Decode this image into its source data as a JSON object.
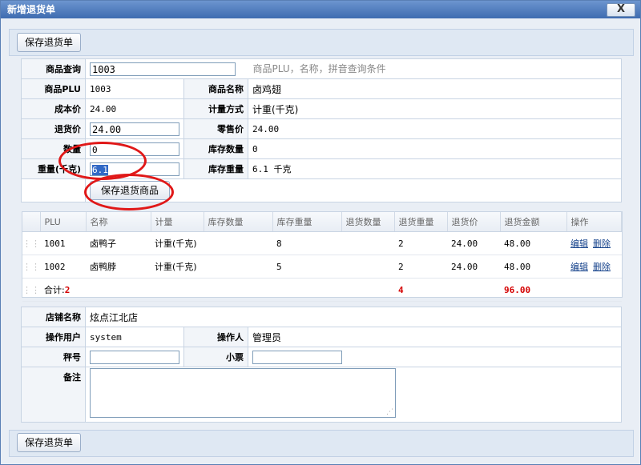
{
  "window": {
    "title": "新增退货单",
    "close_label": "X"
  },
  "toolbar": {
    "save_label": "保存退货单"
  },
  "form": {
    "query_label": "商品查询",
    "query_value": "1003",
    "query_hint": "商品PLU，名称，拼音查询条件",
    "plu_label": "商品PLU",
    "plu_value": "1003",
    "name_label": "商品名称",
    "name_value": "卤鸡翅",
    "cost_label": "成本价",
    "cost_value": "24.00",
    "measure_label": "计量方式",
    "measure_value": "计重(千克)",
    "return_price_label": "退货价",
    "return_price_value": "24.00",
    "retail_label": "零售价",
    "retail_value": "24.00",
    "qty_label": "数量",
    "qty_value": "0",
    "stock_qty_label": "库存数量",
    "stock_qty_value": "0",
    "weight_label": "重量(千克)",
    "weight_value": "6.1",
    "stock_weight_label": "库存重量",
    "stock_weight_value": "6.1 千克",
    "save_item_label": "保存退货商品"
  },
  "grid": {
    "columns": [
      "PLU",
      "名称",
      "计量",
      "库存数量",
      "库存重量",
      "退货数量",
      "退货重量",
      "退货价",
      "退货金额",
      "操作"
    ],
    "rows": [
      {
        "plu": "1001",
        "name": "卤鸭子",
        "measure": "计重(千克)",
        "stock_qty": "",
        "stock_weight": "8",
        "ret_qty": "",
        "ret_weight": "2",
        "price": "24.00",
        "amount": "48.00",
        "edit": "编辑",
        "delete": "删除"
      },
      {
        "plu": "1002",
        "name": "卤鸭脖",
        "measure": "计重(千克)",
        "stock_qty": "",
        "stock_weight": "5",
        "ret_qty": "",
        "ret_weight": "2",
        "price": "24.00",
        "amount": "48.00",
        "edit": "编辑",
        "delete": "删除"
      }
    ],
    "summary": {
      "label": "合计:",
      "count": "2",
      "weight_total": "4",
      "amount_total": "96.00"
    }
  },
  "info": {
    "store_label": "店铺名称",
    "store_value": "炫点江北店",
    "user_label": "操作用户",
    "user_value": "system",
    "operator_label": "操作人",
    "operator_value": "管理员",
    "scale_label": "秤号",
    "scale_value": "",
    "receipt_label": "小票",
    "receipt_value": "",
    "remark_label": "备注",
    "remark_value": ""
  },
  "colors": {
    "title_bar": "#3e6bb0",
    "annotation": "#e01818",
    "total_red": "#d40000",
    "link": "#15428b"
  }
}
